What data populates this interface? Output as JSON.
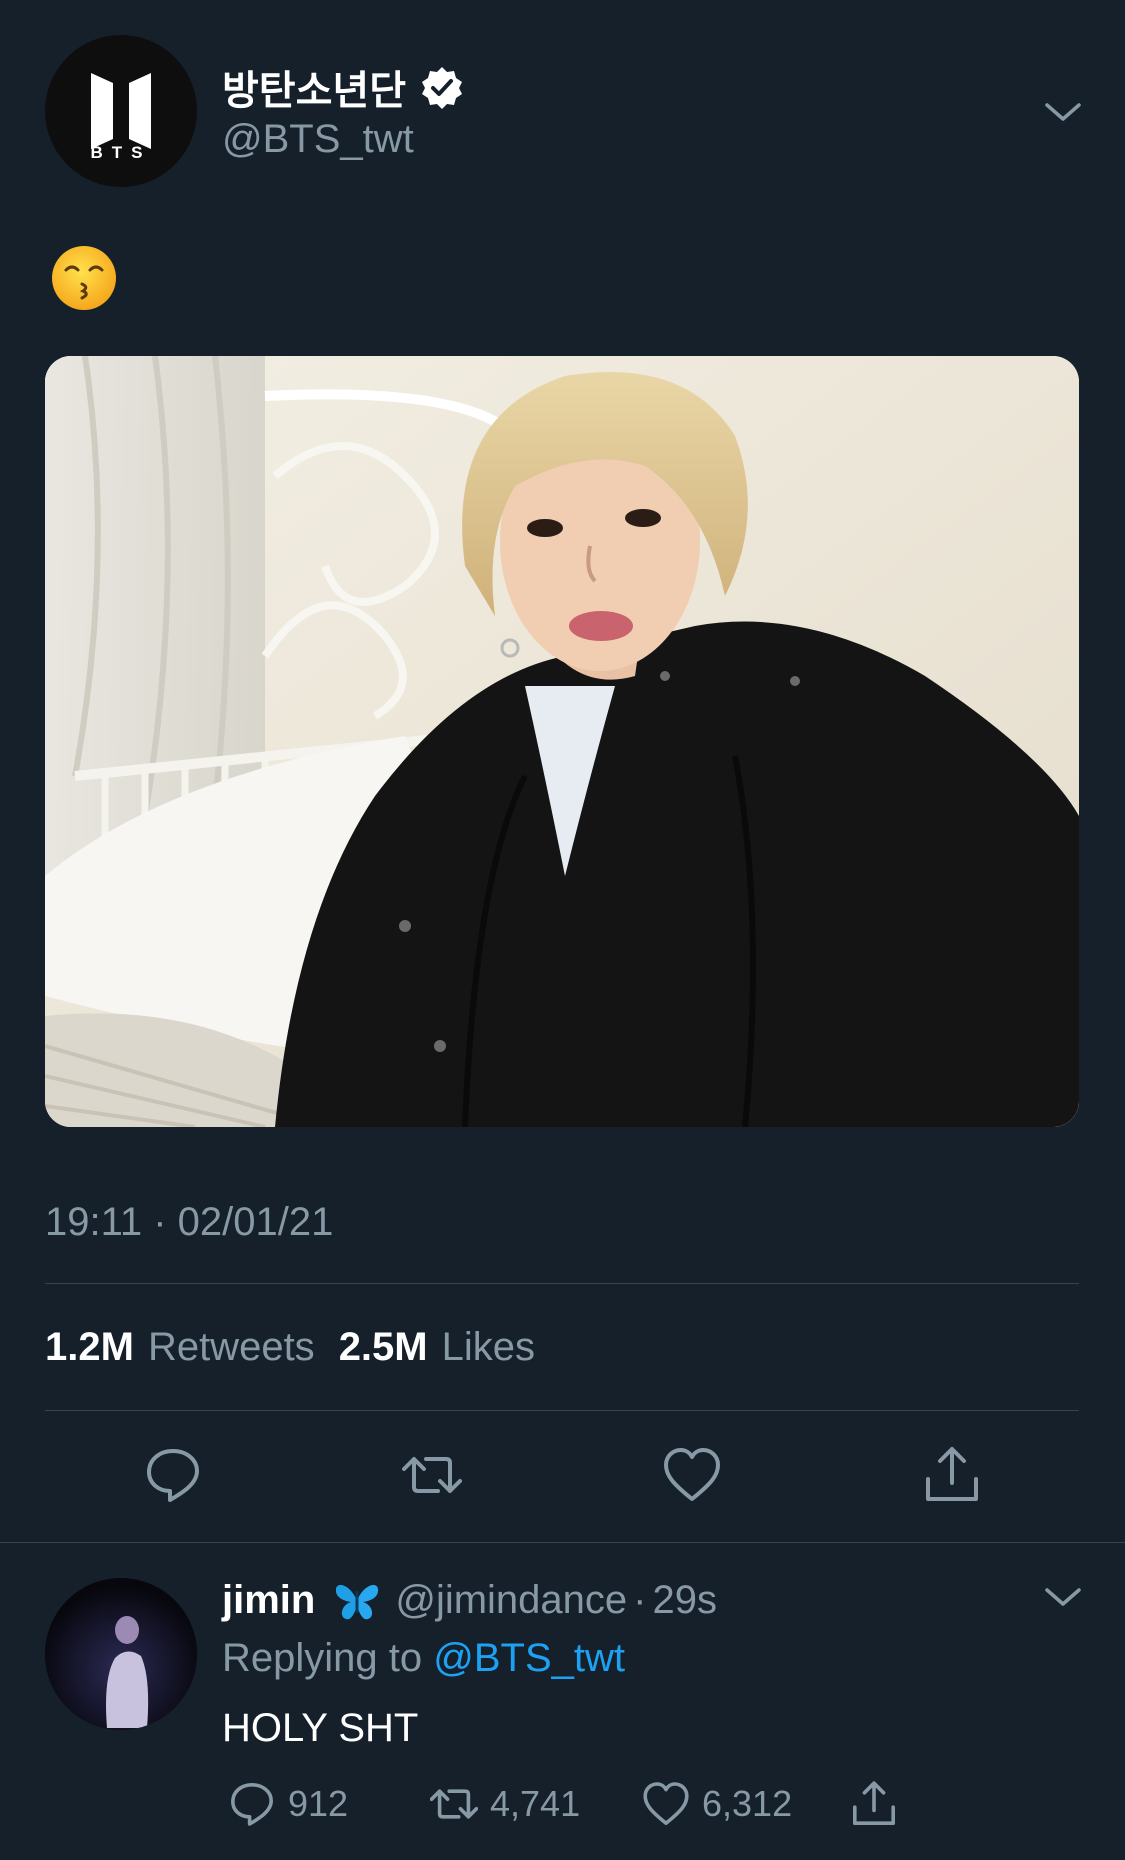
{
  "tweet": {
    "author": {
      "display_name": "방탄소년단",
      "handle": "@BTS_twt",
      "logo_text": "BTS",
      "verified": true
    },
    "body_emoji": "kissing-face-with-smiling-eyes",
    "timestamp": "19:11 · 02/01/21",
    "stats": {
      "retweets_count": "1.2M",
      "retweets_label": "Retweets",
      "likes_count": "2.5M",
      "likes_label": "Likes"
    }
  },
  "reply": {
    "display_name": "jimin",
    "name_emoji": "butterfly",
    "handle": "@jimindance",
    "separator": "·",
    "age": "29s",
    "replying_prefix": "Replying to",
    "replying_to": "@BTS_twt",
    "text": "HOLY SHT",
    "counts": {
      "replies": "912",
      "retweets": "4,741",
      "likes": "6,312"
    }
  },
  "colors": {
    "background": "#15202b",
    "text_primary": "#ffffff",
    "text_muted": "#8899a6",
    "divider": "#38444d",
    "link": "#1da1f2"
  }
}
